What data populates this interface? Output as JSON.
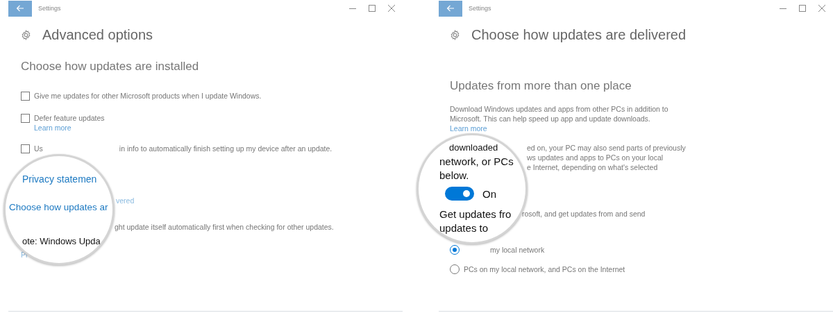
{
  "left_window": {
    "title": "Settings",
    "heading": "Advanced options",
    "section_title": "Choose how updates are installed",
    "options": [
      {
        "label": "Give me updates for other Microsoft products when I update Windows.",
        "checked": false
      },
      {
        "label": "Defer feature updates",
        "checked": false,
        "link": "Learn more"
      }
    ],
    "partial_option": {
      "checked": false,
      "label_start": "Us",
      "label_end": "in info to automatically finish setting up my device after an update."
    },
    "partial_texts": [
      {
        "kind": "link",
        "text": "vered"
      },
      {
        "kind": "plain",
        "text": "ght update itself automatically first when checking for other updates."
      },
      {
        "kind": "link",
        "text": "Pr"
      }
    ],
    "magnifier": [
      {
        "kind": "link",
        "text": "Privacy statemen"
      },
      {
        "kind": "link",
        "text": "Choose how updates ar"
      },
      {
        "kind": "plain",
        "text": "ote: Windows Upda"
      }
    ]
  },
  "right_window": {
    "title": "Settings",
    "heading": "Choose how updates are delivered",
    "section_title": "Updates from more than one place",
    "description": "Download Windows updates and apps from other PCs in addition to Microsoft. This can help speed up app and update downloads.",
    "link": "Learn more",
    "partial_texts": [
      {
        "kind": "plain",
        "text": "ed on, your PC may also send parts of previously"
      },
      {
        "kind": "plain",
        "text": "ws updates and apps to PCs on your local"
      },
      {
        "kind": "plain",
        "text": "e Internet, depending on what's selected"
      },
      {
        "kind": "plain",
        "text": "rosoft, and get updates from and send"
      }
    ],
    "radios": [
      {
        "label": "my local network",
        "selected": true
      },
      {
        "label": "PCs on my local network, and PCs on the Internet",
        "selected": false
      }
    ],
    "magnifier": {
      "lines_top": [
        "downloaded",
        "network, or PCs",
        "below."
      ],
      "toggle": {
        "on": true,
        "label": "On"
      },
      "lines_bottom": [
        "Get updates fro",
        "updates to"
      ]
    }
  }
}
